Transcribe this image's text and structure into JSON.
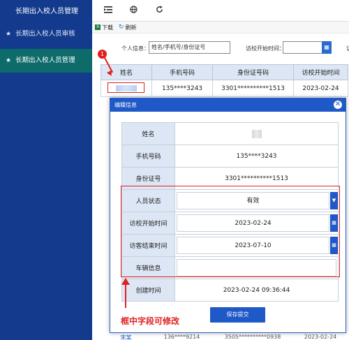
{
  "sidebar": {
    "title": "长期出入校人员管理",
    "items": [
      {
        "label": "长期出入校人员审核"
      },
      {
        "label": "长期出入校人员管理"
      }
    ]
  },
  "toolbar": {
    "download_label": "下载",
    "refresh_label": "刷新"
  },
  "search": {
    "label": "个人信息：",
    "placeholder": "姓名/手机号/身份证号",
    "start_time_label": "访校开始时间：",
    "more_label": "访"
  },
  "table": {
    "columns": [
      "姓名",
      "手机号码",
      "身份证号码",
      "访校开始时间"
    ],
    "rows": [
      {
        "phone": "135****3243",
        "id_number": "3301**********1513",
        "start": "2023-02-24"
      }
    ],
    "partial_row": {
      "name": "宋某",
      "phone": "136****9214",
      "id_number": "3505**********0938",
      "start": "2023-02-24"
    }
  },
  "annotation": {
    "badge": "1",
    "hint": "框中字段可修改"
  },
  "modal": {
    "title": "编辑信息",
    "close": "✕",
    "fields": [
      {
        "label": "姓名",
        "value": ""
      },
      {
        "label": "手机号码",
        "value": "135****3243"
      },
      {
        "label": "身份证号",
        "value": "3301**********1513"
      },
      {
        "label": "人员状态",
        "value": "有效"
      },
      {
        "label": "访校开始时间",
        "value": "2023-02-24"
      },
      {
        "label": "访客结束时间",
        "value": "2023-07-10"
      },
      {
        "label": "车辆信息",
        "value": ""
      },
      {
        "label": "创建时间",
        "value": "2023-02-24 09:36:44"
      }
    ],
    "save_label": "保存提交"
  },
  "colors": {
    "sidebar_bg": "#133a8c",
    "active_item": "#0d6b6a",
    "primary": "#1f58c7",
    "annotation": "#e02020"
  }
}
